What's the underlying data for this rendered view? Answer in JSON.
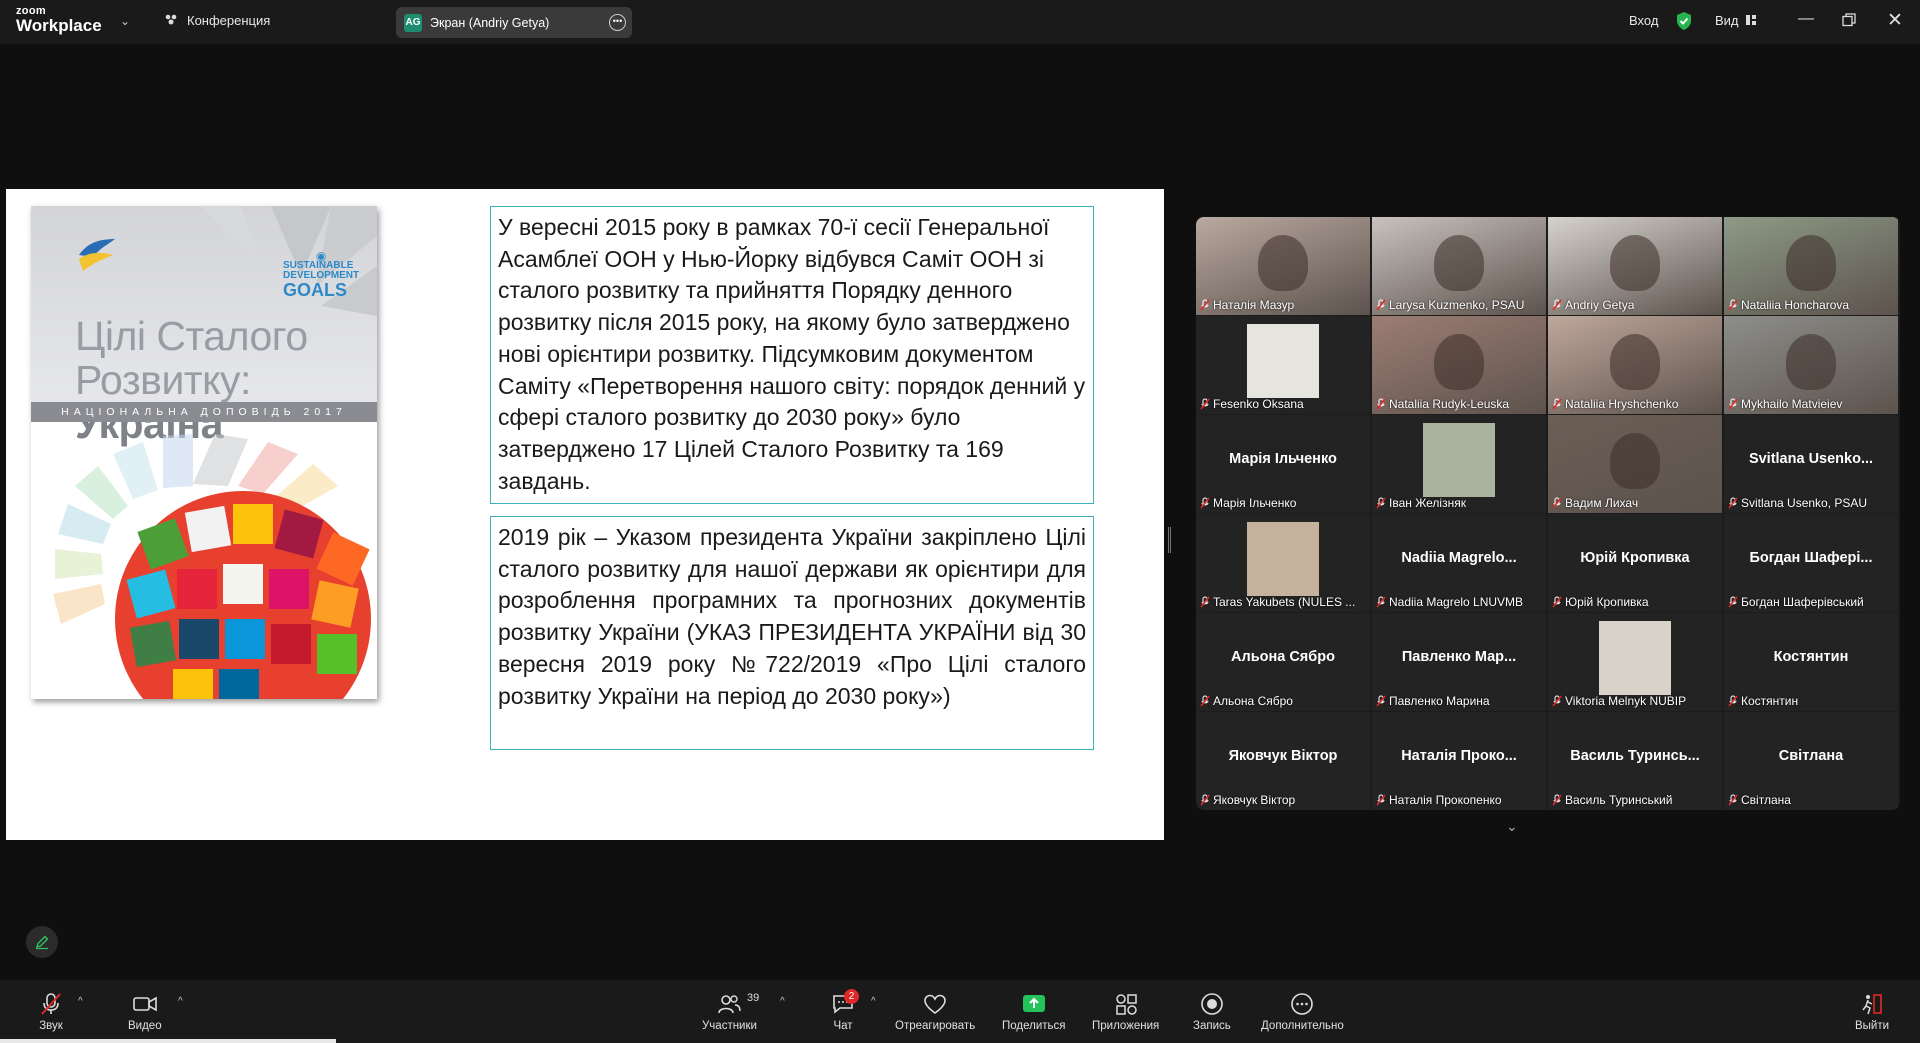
{
  "topbar": {
    "logo_top": "zoom",
    "logo_bottom": "Workplace",
    "conference_label": "Конференция",
    "screen_tab_initials": "AG",
    "screen_tab_label": "Экран (Andriy Getya)",
    "signin_label": "Вход",
    "view_label": "Вид"
  },
  "slide": {
    "cover": {
      "title_line1": "Цілі Сталого",
      "title_line2_prefix": "Розвитку: ",
      "title_line2_bold": "Україна",
      "band_text": "НАЦІОНАЛЬНА ДОПОВІДЬ 2017",
      "sdg_line1": "SUSTAINABLE",
      "sdg_line2": "DEVELOPMENT",
      "sdg_line3": "GOALS"
    },
    "text1": "У вересні 2015 року в рамках 70-ї сесії Генеральної Асамблеї ООН у Нью-Йорку відбувся Саміт ООН зі сталого розвитку та прийняття Порядку денного розвитку після 2015 року, на якому було затверджено нові орієнтири розвитку. Підсумковим документом Саміту «Перетворення нашого світу: порядок денний у сфері сталого розвитку до 2030 року» було затверджено 17 Цілей Сталого Розвитку та 169 завдань.",
    "text2": " 2019 рік – Указом президента України  закріплено Цілі сталого розвитку для нашої держави як орієнтири для розроблення програмних та прогнозних документів розвитку України (УКАЗ ПРЕЗИДЕНТА УКРАЇНИ від 30 вересня 2019 року №722/2019 «Про Цілі сталого розвитку України на період до 2030 року»)"
  },
  "participants": [
    {
      "label": "Наталія Мазур",
      "big": "",
      "bg": "#b9a9a0"
    },
    {
      "label": "Larysa Kuzmenko, PSAU",
      "big": "",
      "bg": "#c9c2bd"
    },
    {
      "label": "Andriy Getya",
      "big": "",
      "bg": "#d6d2cc"
    },
    {
      "label": "Nataliia Honcharova",
      "big": "",
      "bg": "#8c9a86"
    },
    {
      "label": "Fesenko Oksana",
      "big": "",
      "bg": "#232323"
    },
    {
      "label": "Nataliia Rudyk-Leuska",
      "big": "",
      "bg": "#9c7d74"
    },
    {
      "label": "Nataliia Hryshchenko",
      "big": "",
      "bg": "#bfa79b"
    },
    {
      "label": "Mykhailo Matvieiev",
      "big": "",
      "bg": "#8d8e8a"
    },
    {
      "label": "Марія Ільченко",
      "big": "Марія Ільченко",
      "bg": "#232323"
    },
    {
      "label": "Іван Желізняк",
      "big": "",
      "bg": "#232323"
    },
    {
      "label": "Вадим Лихач",
      "big": "",
      "bg": "#6b5e55"
    },
    {
      "label": "Svitlana Usenko, PSAU",
      "big": "Svitlana  Usenko...",
      "bg": "#232323"
    },
    {
      "label": "Taras Yakubets (NULES ...",
      "big": "",
      "bg": "#232323"
    },
    {
      "label": "Nadiia Magrelo LNUVMB",
      "big": "Nadiia  Magrelo...",
      "bg": "#232323"
    },
    {
      "label": "Юрій Кропивка",
      "big": "Юрій Кропивка",
      "bg": "#232323"
    },
    {
      "label": "Богдан Шаферівський",
      "big": "Богдан  Шафері...",
      "bg": "#232323"
    },
    {
      "label": "Альона Сябро",
      "big": "Альона Сябро",
      "bg": "#232323"
    },
    {
      "label": "Павленко Марина",
      "big": "Павленко  Мар...",
      "bg": "#232323"
    },
    {
      "label": "Viktoria Melnyk NUBIP",
      "big": "",
      "bg": "#232323"
    },
    {
      "label": "Костянтин",
      "big": "Костянтин",
      "bg": "#232323"
    },
    {
      "label": "Яковчук Віктор",
      "big": "Яковчук Віктор",
      "bg": "#232323"
    },
    {
      "label": "Наталія Прокопенко",
      "big": "Наталія  Проко...",
      "bg": "#232323"
    },
    {
      "label": "Василь Туринський",
      "big": "Василь  Туринсь...",
      "bg": "#232323"
    },
    {
      "label": "Світлана",
      "big": "Світлана",
      "bg": "#232323"
    }
  ],
  "toolbar": {
    "audio": "Звук",
    "video": "Видео",
    "participants": "Участники",
    "participants_count": "39",
    "chat": "Чат",
    "chat_badge": "2",
    "react": "Отреагировать",
    "share": "Поделиться",
    "apps": "Приложения",
    "record": "Запись",
    "more": "Дополнительно",
    "leave": "Выйти"
  },
  "colors": {
    "accent_green": "#2ec15e",
    "share_green": "#24c25a",
    "slide_border": "#3fb1bb",
    "mute_red": "#e02828"
  }
}
